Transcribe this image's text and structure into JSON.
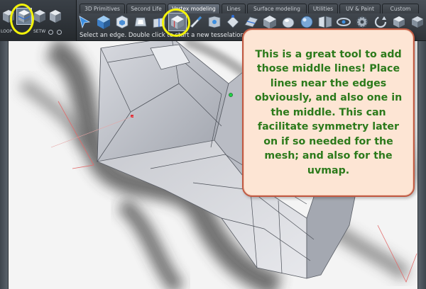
{
  "left_tools": {
    "label_left": "LOOP",
    "label_right": "SETW"
  },
  "tabs": [
    {
      "label": "3D Primitives",
      "active": false
    },
    {
      "label": "Second Life",
      "active": false
    },
    {
      "label": "Vertex modeling",
      "active": true
    },
    {
      "label": "Lines",
      "active": false
    },
    {
      "label": "Surface modeling",
      "active": false
    },
    {
      "label": "Utilities",
      "active": false
    },
    {
      "label": "UV & Paint",
      "active": false
    },
    {
      "label": "Custom",
      "active": false
    }
  ],
  "status": {
    "text": "Select an edge. Double click to start a new tesselation"
  },
  "callout": {
    "text": "This is a great tool to add those middle lines! Place lines near the edges obviously, and also one in the middle. This can facilitate symmetry later on if so needed for the mesh; and also for the uvmap."
  },
  "colors": {
    "highlight_circle": "#f3f20a",
    "callout_border": "#c15a43",
    "callout_fill": "#fde5d4",
    "callout_text": "#2c7a1b",
    "active_tab": "#6b7480"
  }
}
